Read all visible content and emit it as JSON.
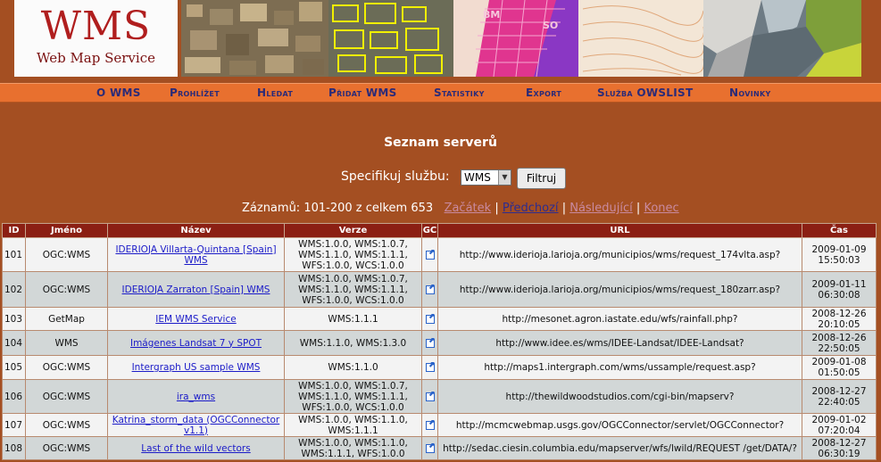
{
  "header": {
    "logo_title": "WMS",
    "logo_subtitle": "Web Map Service",
    "map_labels": [
      "BM",
      "SO"
    ]
  },
  "nav": {
    "items": [
      "O WMS",
      "Prohlížet",
      "Hledat",
      "Přidat WMS",
      "Statistiky",
      "Export",
      "Služba OWSLIST",
      "Novinky"
    ]
  },
  "page": {
    "title": "Seznam serverů",
    "filter_label": "Specifikuj službu:",
    "filter_select_value": "WMS",
    "filter_button": "Filtruj",
    "records_text": "Záznamů: 101-200 z celkem 653",
    "pager": {
      "first": "Začátek",
      "prev": "Předchozí",
      "next": "Následující",
      "last": "Konec",
      "separator": "|"
    }
  },
  "table": {
    "columns": [
      "ID",
      "Jméno",
      "Název",
      "Verze",
      "GC",
      "URL",
      "Čas"
    ],
    "rows": [
      {
        "id": "101",
        "jmeno": "OGC:WMS",
        "nazev": "IDERIOJA Villarta-Quintana [Spain] WMS",
        "verze": "WMS:1.0.0, WMS:1.0.7, WMS:1.1.0, WMS:1.1.1, WFS:1.0.0, WCS:1.0.0",
        "url": "http://www.iderioja.larioja.org/municipios/wms/request_174vlta.asp?",
        "cas": "2009-01-09 15:50:03"
      },
      {
        "id": "102",
        "jmeno": "OGC:WMS",
        "nazev": "IDERIOJA Zarraton [Spain] WMS",
        "verze": "WMS:1.0.0, WMS:1.0.7, WMS:1.1.0, WMS:1.1.1, WFS:1.0.0, WCS:1.0.0",
        "url": "http://www.iderioja.larioja.org/municipios/wms/request_180zarr.asp?",
        "cas": "2009-01-11 06:30:08"
      },
      {
        "id": "103",
        "jmeno": "GetMap",
        "nazev": "IEM WMS Service",
        "verze": "WMS:1.1.1",
        "url": "http://mesonet.agron.iastate.edu/wfs/rainfall.php?",
        "cas": "2008-12-26 20:10:05"
      },
      {
        "id": "104",
        "jmeno": "WMS",
        "nazev": "Imágenes Landsat 7 y SPOT",
        "verze": "WMS:1.1.0, WMS:1.3.0",
        "url": "http://www.idee.es/wms/IDEE-Landsat/IDEE-Landsat?",
        "cas": "2008-12-26 22:50:05"
      },
      {
        "id": "105",
        "jmeno": "OGC:WMS",
        "nazev": "Intergraph US sample WMS",
        "verze": "WMS:1.1.0",
        "url": "http://maps1.intergraph.com/wms/ussample/request.asp?",
        "cas": "2009-01-08 01:50:05"
      },
      {
        "id": "106",
        "jmeno": "OGC:WMS",
        "nazev": "ira_wms",
        "verze": "WMS:1.0.0, WMS:1.0.7, WMS:1.1.0, WMS:1.1.1, WFS:1.0.0, WCS:1.0.0",
        "url": "http://thewildwoodstudios.com/cgi-bin/mapserv?",
        "cas": "2008-12-27 22:40:05"
      },
      {
        "id": "107",
        "jmeno": "OGC:WMS",
        "nazev": "Katrina_storm_data (OGCConnector v1.1)",
        "verze": "WMS:1.0.0, WMS:1.1.0, WMS:1.1.1",
        "url": "http://mcmcwebmap.usgs.gov/OGCConnector/servlet/OGCConnector?",
        "cas": "2009-01-02 07:20:04"
      },
      {
        "id": "108",
        "jmeno": "OGC:WMS",
        "nazev": "Last of the wild vectors",
        "verze": "WMS:1.0.0, WMS:1.1.0, WMS:1.1.1, WFS:1.0.0",
        "url": "http://sedac.ciesin.columbia.edu/mapserver/wfs/lwild/REQUEST /get/DATA/?",
        "cas": "2008-12-27 06:30:19"
      }
    ]
  },
  "colors": {
    "page_bg": "#a44f22",
    "nav_bg": "#e8702f",
    "nav_text": "#2a2a78",
    "header_cell_bg": "#8b1f13",
    "row_light": "#f3f3f3",
    "row_dark": "#d2d7d7",
    "logo_red": "#b01e1e"
  },
  "icons": {
    "gc": "external-link-icon",
    "select_arrow": "chevron-down-icon"
  }
}
